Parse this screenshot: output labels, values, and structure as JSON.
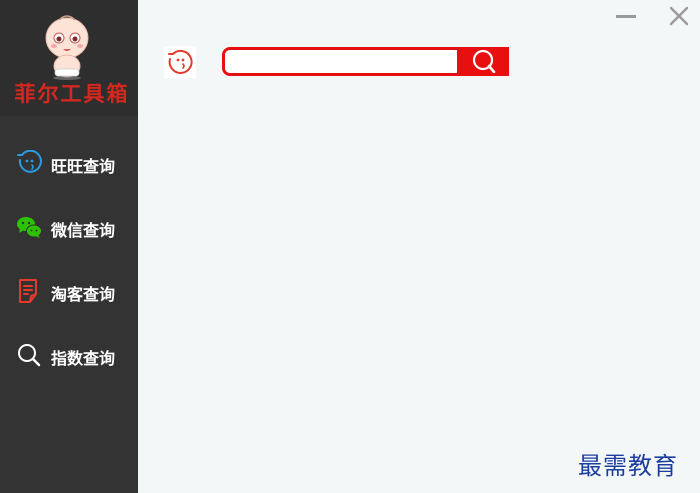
{
  "brand": {
    "name": "菲尔工具箱",
    "name_color": "#d3281f"
  },
  "sidebar": {
    "background": "#333333",
    "items": [
      {
        "label": "旺旺查询",
        "icon": "wangwang-icon",
        "icon_color": "#2b9be0"
      },
      {
        "label": "微信查询",
        "icon": "wechat-icon",
        "icon_color": "#2dc100"
      },
      {
        "label": "淘客查询",
        "icon": "document-icon",
        "icon_color": "#e23b2c"
      },
      {
        "label": "指数查询",
        "icon": "search-icon",
        "icon_color": "#ffffff"
      }
    ]
  },
  "search": {
    "value": "",
    "placeholder": "",
    "accent": "#e70f0f"
  },
  "window_controls": [
    "minimize-icon",
    "close-icon"
  ],
  "watermark": "最需教育"
}
